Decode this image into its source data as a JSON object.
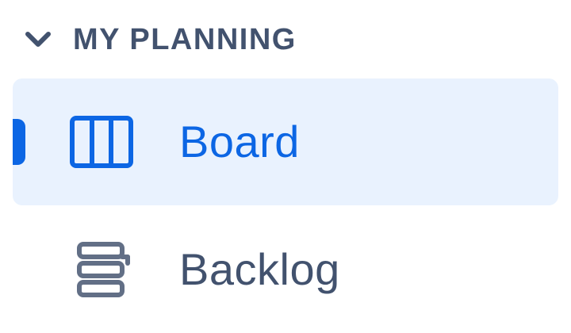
{
  "sidebar": {
    "section": {
      "title": "MY PLANNING",
      "expanded": true,
      "icon": "chevron-down-icon"
    },
    "items": [
      {
        "label": "Board",
        "icon": "board-columns-icon",
        "active": true
      },
      {
        "label": "Backlog",
        "icon": "backlog-list-icon",
        "active": false
      }
    ]
  },
  "colors": {
    "accent": "#0c66e4",
    "active_background": "#e9f2fe",
    "text_secondary": "#42526e",
    "icon_muted": "#626f86"
  }
}
